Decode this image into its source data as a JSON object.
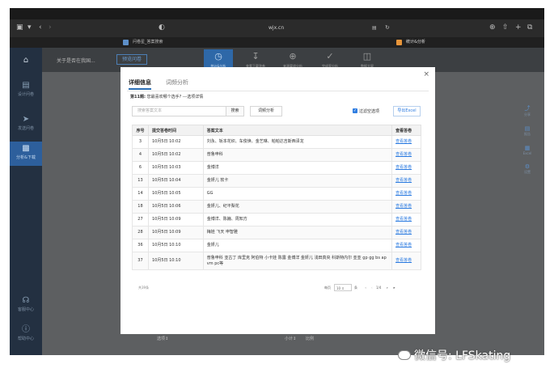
{
  "browser": {
    "url": "wjx.cn",
    "tabs": [
      {
        "label": "问卷星_答案搜索",
        "icon": "wjx-favicon"
      },
      {
        "label": "统计&分析",
        "icon": "orange-favicon"
      }
    ]
  },
  "app": {
    "survey_title": "关于是否在我国...",
    "preview_label": "预览问卷",
    "left_nav": [
      {
        "label": "设计问卷",
        "icon": "document-icon"
      },
      {
        "label": "发送问卷",
        "icon": "send-icon"
      },
      {
        "label": "分析&下载",
        "icon": "chart-icon"
      },
      {
        "label": "客服中心",
        "icon": "headset-icon"
      },
      {
        "label": "帮助中心",
        "icon": "help-icon"
      }
    ],
    "top_tools": [
      {
        "label": "统计&分析",
        "icon": "clock-icon"
      },
      {
        "label": "查看下载答卷",
        "icon": "download-icon"
      },
      {
        "label": "来源渠道分析",
        "icon": "target-icon"
      },
      {
        "label": "完成率分析",
        "icon": "check-circle-icon"
      },
      {
        "label": "数据大屏",
        "icon": "monitor-icon"
      }
    ],
    "right_tools": [
      {
        "label": "分享",
        "icon": "share-icon"
      },
      {
        "label": "报告",
        "icon": "report-icon"
      },
      {
        "label": "Excel",
        "icon": "excel-icon"
      },
      {
        "label": "设置",
        "icon": "settings-icon"
      }
    ],
    "bottom_strip": {
      "option_label": "选项↕",
      "count_label": "小计↕",
      "ratio_label": "比例"
    }
  },
  "modal": {
    "tabs": [
      "详细信息",
      "词频分析"
    ],
    "question_prefix": "第11题:",
    "question_text": "您最喜欢哪个选手? ---选项详情",
    "search_placeholder": "搜索答案文本",
    "search_label": "搜索",
    "freq_label": "词频分析",
    "filter_label": "过滤空选项",
    "export_label": "导出Excel",
    "columns": [
      "序号",
      "提交答卷时间",
      "答案文本",
      "查看答卷"
    ],
    "rows": [
      {
        "id": "3",
        "time": "10月5日 10:02",
        "text": "刘永、坂本花织、车俊焕、金艺琳、帕帕达吉斯西泽龙",
        "action": "查看答卷"
      },
      {
        "id": "4",
        "time": "10月5日 10:02",
        "text": "普鲁申科",
        "action": "查看答卷"
      },
      {
        "id": "6",
        "time": "10月5日 10:03",
        "text": "金博洋",
        "action": "查看答卷"
      },
      {
        "id": "13",
        "time": "10月5日 10:04",
        "text": "金妍儿 软卡",
        "action": "查看答卷"
      },
      {
        "id": "14",
        "time": "10月5日 10:05",
        "text": "GG",
        "action": "查看答卷"
      },
      {
        "id": "18",
        "time": "10月5日 10:06",
        "text": "金妍儿、纪平梨花",
        "action": "查看答卷"
      },
      {
        "id": "27",
        "time": "10月5日 10:09",
        "text": "金博洋、陈巍、周知方",
        "action": "查看答卷"
      },
      {
        "id": "28",
        "time": "10月5日 10:09",
        "text": "梅娃 飞天 申智雅",
        "action": "查看答卷"
      },
      {
        "id": "36",
        "time": "10月5日 10:10",
        "text": "金妍儿",
        "action": "查看答卷"
      },
      {
        "id": "37",
        "time": "10月5日 10:10",
        "text": "普鲁申科 亚古丁 库里克 阿伯特 小卡娃 陈露 金博洋 金妍儿 浅田真央 科斯特内尔 亚亚 gp gg bs ap vm pc等",
        "action": "查看答卷"
      }
    ],
    "total_text": "共39条",
    "pager": {
      "per_page_label": "每页",
      "per_page_value": "10",
      "unit_label": "条",
      "page_info": "1/4"
    }
  },
  "watermark": "微信号: LFSkating",
  "colors": {
    "accent": "#2f7de1",
    "nav_bg": "#233041",
    "active_nav": "#2d5f9c"
  }
}
